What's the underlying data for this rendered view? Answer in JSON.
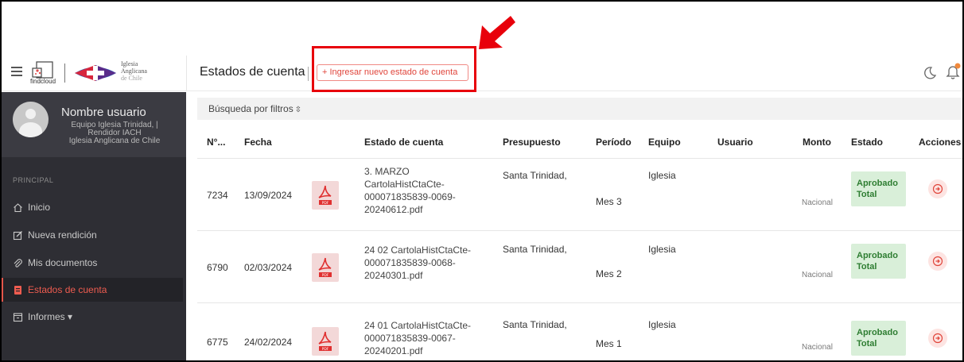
{
  "header": {
    "logo_text": "findcloud",
    "church_lines": [
      "Iglesia",
      "Anglicana",
      "de Chile"
    ],
    "page_title": "Estados de cuenta",
    "new_button": "+ Ingresar nuevo estado de cuenta"
  },
  "sidebar": {
    "user": {
      "name": "Nombre usuario",
      "line1": "Equipo Iglesia Trinidad, |",
      "line2": "Rendidor IACH",
      "line3": "Iglesia Anglicana de Chile"
    },
    "section": "PRINCIPAL",
    "items": [
      {
        "label": "Inicio",
        "icon": "home-icon"
      },
      {
        "label": "Nueva rendición",
        "icon": "edit-icon"
      },
      {
        "label": "Mis documentos",
        "icon": "paperclip-icon"
      },
      {
        "label": "Estados de cuenta",
        "icon": "document-icon",
        "active": true
      },
      {
        "label": "Informes ▾",
        "icon": "inbox-icon"
      }
    ]
  },
  "filters": {
    "label": "Búsqueda por filtros",
    "arrow": "⇳"
  },
  "table": {
    "columns": [
      "N°...",
      "Fecha",
      "Estado de cuenta",
      "Presupuesto",
      "Período",
      "Equipo",
      "Usuario",
      "Monto",
      "Estado",
      "Acciones"
    ],
    "rows": [
      {
        "num": "7234",
        "fecha": "13/09/2024",
        "file_lines": [
          "3. MARZO",
          "CartolaHistCtaCte-",
          "000071835839-0069-",
          "20240612.pdf"
        ],
        "presupuesto": "Santa Trinidad,",
        "periodo": "Mes 3",
        "equipo": "Iglesia",
        "monto_sub": "Nacional",
        "estado_lines": [
          "Aprobado",
          "Total"
        ]
      },
      {
        "num": "6790",
        "fecha": "02/03/2024",
        "file_lines": [
          "24 02 CartolaHistCtaCte-",
          "000071835839-0068-",
          "20240301.pdf"
        ],
        "presupuesto": "Santa Trinidad,",
        "periodo": "Mes 2",
        "equipo": "Iglesia",
        "monto_sub": "Nacional",
        "estado_lines": [
          "Aprobado",
          "Total"
        ]
      },
      {
        "num": "6775",
        "fecha": "24/02/2024",
        "file_lines": [
          "24 01 CartolaHistCtaCte-",
          "000071835839-0067-",
          "20240201.pdf"
        ],
        "presupuesto": "Santa Trinidad,",
        "periodo": "Mes 1",
        "equipo": "Iglesia",
        "monto_sub": "Nacional",
        "estado_lines": [
          "Aprobado",
          "Total"
        ]
      }
    ]
  },
  "colors": {
    "accent": "#e0453b",
    "sidebar_bg": "#2e2e34",
    "badge_bg": "#d9efd9",
    "badge_text": "#2e7d32",
    "highlight": "#e8000b"
  }
}
